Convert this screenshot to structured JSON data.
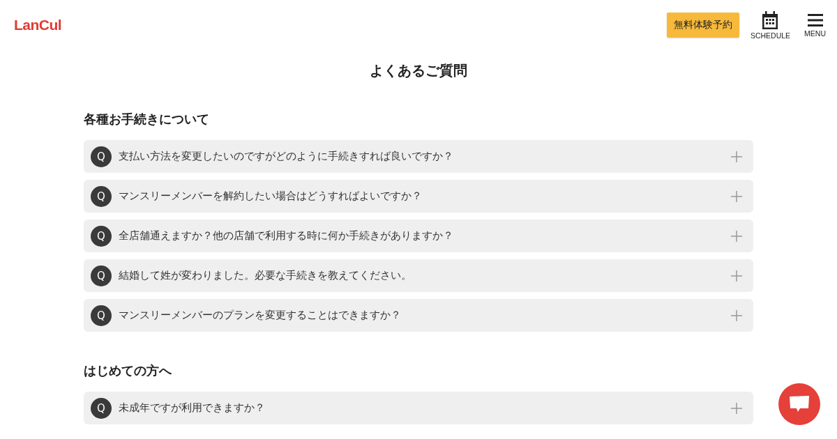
{
  "header": {
    "logo": "LanCul",
    "cta_button": "無料体験予約",
    "nav": [
      {
        "kind": "calendar",
        "label": "SCHEDULE"
      },
      {
        "kind": "menu",
        "label": "MENU"
      }
    ]
  },
  "page_title": "よくあるご質問",
  "sections": [
    {
      "heading": "各種お手続きについて",
      "items": [
        {
          "mark": "Q",
          "question": "支払い方法を変更したいのですがどのように手続きすれば良いですか？",
          "expanded": false
        },
        {
          "mark": "Q",
          "question": "マンスリーメンバーを解約したい場合はどうすればよいですか？",
          "expanded": false
        },
        {
          "mark": "Q",
          "question": "全店舗通えますか？他の店舗で利用する時に何か手続きがありますか？",
          "expanded": false
        },
        {
          "mark": "Q",
          "question": "結婚して姓が変わりました。必要な手続きを教えてください。",
          "expanded": false
        },
        {
          "mark": "Q",
          "question": "マンスリーメンバーのプランを変更することはできますか？",
          "expanded": false
        }
      ]
    },
    {
      "heading": "はじめての方へ",
      "items": [
        {
          "mark": "Q",
          "question": "未成年ですが利用できますか？",
          "expanded": false
        }
      ]
    }
  ]
}
